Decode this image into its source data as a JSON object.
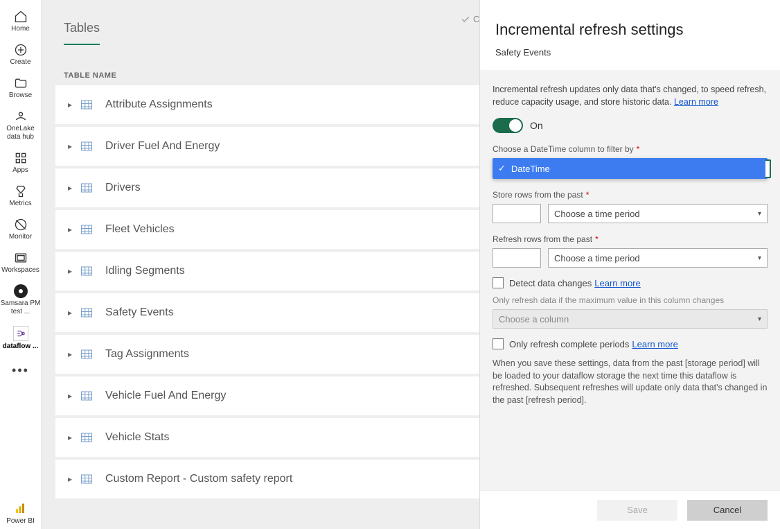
{
  "leftnav": {
    "home": "Home",
    "create": "Create",
    "browse": "Browse",
    "onelake": "OneLake data hub",
    "apps": "Apps",
    "metrics": "Metrics",
    "monitor": "Monitor",
    "workspaces": "Workspaces",
    "samsara": "Samsara PM test ...",
    "dataflow": "dataflow ...",
    "powerbi": "Power BI"
  },
  "status_saved": "Changes sav",
  "tab_tables": "Tables",
  "table_name_header": "TABLE NAME",
  "tables": [
    "Attribute Assignments",
    "Driver Fuel And Energy",
    "Drivers",
    "Fleet Vehicles",
    "Idling Segments",
    "Safety Events",
    "Tag Assignments",
    "Vehicle Fuel And Energy",
    "Vehicle Stats",
    "Custom Report - Custom safety report"
  ],
  "panel": {
    "title": "Incremental refresh settings",
    "subtitle": "Safety Events",
    "intro": "Incremental refresh updates only data that's changed, to speed refresh, reduce capacity usage, and store historic data. ",
    "learn_more": "Learn more",
    "toggle_label": "On",
    "filter_label": "Choose a DateTime column to filter by",
    "filter_option": "DateTime",
    "store_label": "Store rows from the past",
    "refresh_label": "Refresh rows from the past",
    "time_placeholder": "Choose a time period",
    "detect_label": "Detect data changes",
    "detect_note": "Only refresh data if the maximum value in this column changes",
    "column_placeholder": "Choose a column",
    "complete_label": "Only refresh complete periods",
    "save_note": "When you save these settings, data from the past [storage period] will be loaded to your dataflow storage the next time this dataflow is refreshed. Subsequent refreshes will update only data that's changed in the past [refresh period].",
    "save": "Save",
    "cancel": "Cancel"
  }
}
